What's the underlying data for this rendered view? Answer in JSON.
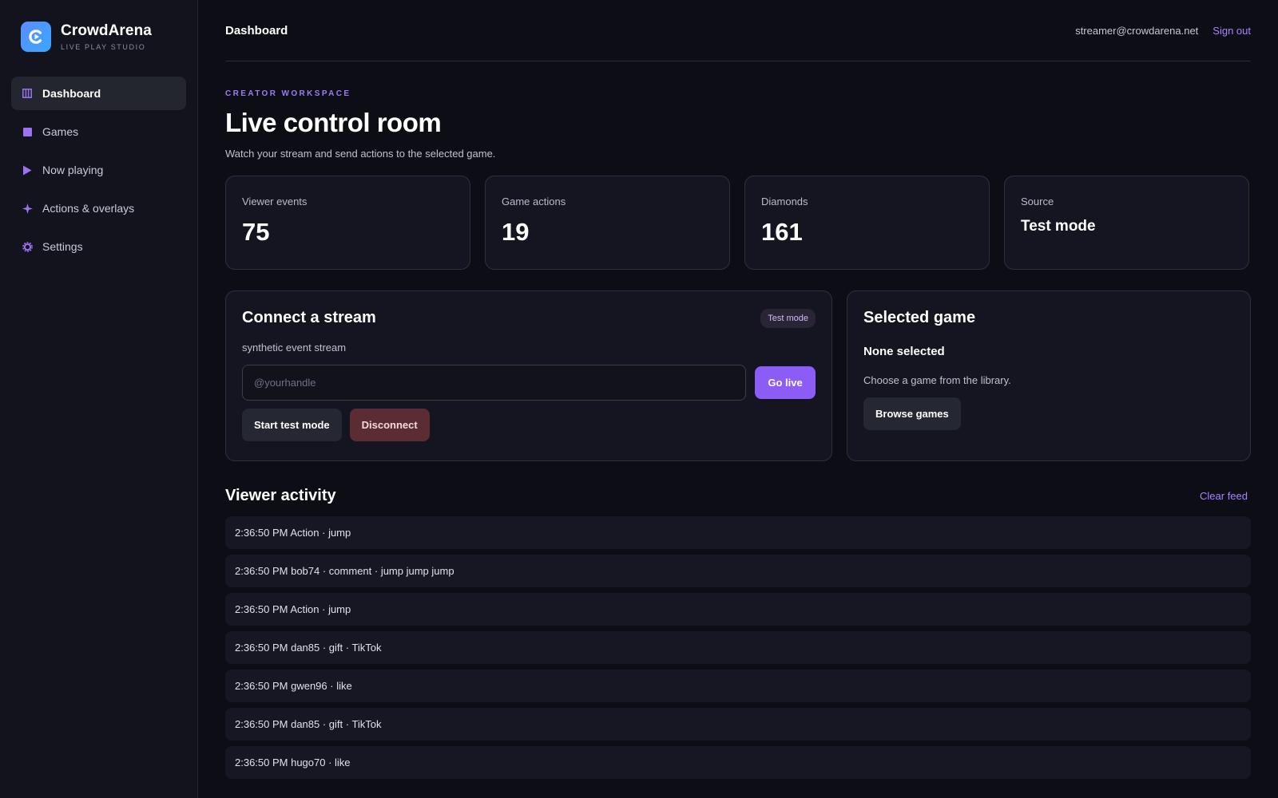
{
  "brand": {
    "name": "CrowdArena",
    "subtitle": "LIVE PLAY STUDIO",
    "logo_icon": "play-circle-icon",
    "logo_color": "#4f94ff"
  },
  "sidebar": {
    "items": [
      {
        "label": "Dashboard",
        "icon": "columns-icon",
        "active": true
      },
      {
        "label": "Games",
        "icon": "square-icon",
        "active": false
      },
      {
        "label": "Now playing",
        "icon": "play-icon",
        "active": false
      },
      {
        "label": "Actions & overlays",
        "icon": "sparkle-icon",
        "active": false
      },
      {
        "label": "Settings",
        "icon": "gear-icon",
        "active": false
      }
    ]
  },
  "header": {
    "title": "Dashboard",
    "user_email": "streamer@crowdarena.net",
    "signout_label": "Sign out"
  },
  "hero": {
    "eyebrow": "CREATOR WORKSPACE",
    "title": "Live control room",
    "subtitle": "Watch your stream and send actions to the selected game."
  },
  "stats": [
    {
      "label": "Viewer events",
      "value": "75"
    },
    {
      "label": "Game actions",
      "value": "19"
    },
    {
      "label": "Diamonds",
      "value": "161"
    },
    {
      "label": "Source",
      "value": "Test mode"
    }
  ],
  "stream_panel": {
    "title": "Connect a stream",
    "badge": "Test mode",
    "note": "synthetic event stream",
    "input_placeholder": "@yourhandle",
    "input_value": "",
    "go_live_label": "Go live",
    "start_test_label": "Start test mode",
    "disconnect_label": "Disconnect"
  },
  "game_panel": {
    "title": "Selected game",
    "name": "None selected",
    "note": "Choose a game from the library.",
    "browse_label": "Browse games"
  },
  "activity": {
    "title": "Viewer activity",
    "clear_label": "Clear feed",
    "rows": [
      "2:36:50 PM Action · jump",
      "2:36:50 PM bob74 · comment · jump jump jump",
      "2:36:50 PM Action · jump",
      "2:36:50 PM dan85 · gift · TikTok",
      "2:36:50 PM gwen96 · like",
      "2:36:50 PM dan85 · gift · TikTok",
      "2:36:50 PM hugo70 · like"
    ]
  },
  "colors": {
    "accent": "#8b5cf6",
    "link": "#a883ff",
    "danger": "#5c2c33",
    "background": "#0d0e15",
    "sidebar": "#12131c"
  }
}
